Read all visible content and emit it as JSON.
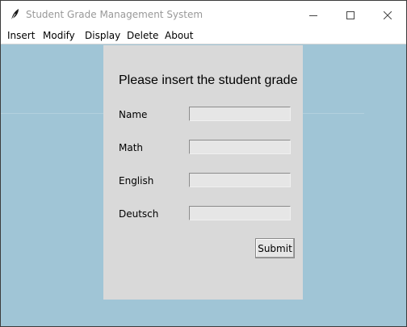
{
  "window": {
    "title": "Student Grade Management System",
    "app_icon": "feather-icon",
    "controls": [
      "minimize-icon",
      "maximize-icon",
      "close-icon"
    ]
  },
  "menu": {
    "items": [
      {
        "label": "Insert"
      },
      {
        "label": "Modify"
      },
      {
        "label": "Display"
      },
      {
        "label": "Delete"
      },
      {
        "label": "About"
      }
    ]
  },
  "form": {
    "heading": "Please insert the student grade",
    "fields": [
      {
        "label": "Name",
        "value": ""
      },
      {
        "label": "Math",
        "value": ""
      },
      {
        "label": "English",
        "value": ""
      },
      {
        "label": "Deutsch",
        "value": ""
      }
    ],
    "submit_label": "Submit"
  },
  "colors": {
    "background": "#a0c5d6",
    "panel": "#d9d9d9",
    "title_text": "#999999"
  }
}
